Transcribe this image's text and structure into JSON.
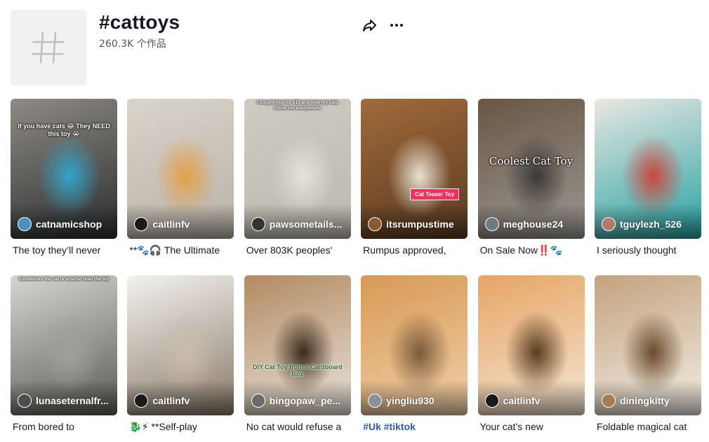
{
  "header": {
    "title": "#cattoys",
    "count": "260.3K 个作品",
    "share_icon": "share-icon",
    "more_icon": "more-icon"
  },
  "videos": [
    {
      "author": "catnamicshop",
      "caption": "The toy they’ll never",
      "overlay": "If you have cats 😂 They NEED this toy 😭",
      "colors": [
        "#8f8a82",
        "#2a2e31",
        "#2fa5c9"
      ],
      "avatar_color": "#4a90c2"
    },
    {
      "author": "caitlinfv",
      "caption": "**🐾🎧 The Ultimate",
      "overlay": "",
      "colors": [
        "#d9d4cc",
        "#b8b2a6",
        "#e2a14a"
      ],
      "avatar_color": "#1a1a1a"
    },
    {
      "author": "pawsometails...",
      "caption": "Over 803K peoples'",
      "overlay": "I bought this for $10 and now my cats follow me everywhere",
      "colors": [
        "#cfcbc3",
        "#bdb8ae",
        "#e6e2da"
      ],
      "avatar_color": "#333333"
    },
    {
      "author": "itsrumpustime",
      "caption": "Rumpus approved,",
      "overlay": "Cat Teaser Toy",
      "colors": [
        "#a06a3c",
        "#5b3a1f",
        "#e9e1d4"
      ],
      "avatar_color": "#8a5a33"
    },
    {
      "author": "meghouse24",
      "caption": "On Sale Now‼️🐾",
      "overlay": "Coolest Cat Toy",
      "colors": [
        "#6a5644",
        "#9b9893",
        "#3c3a38"
      ],
      "avatar_color": "#6f7a7f"
    },
    {
      "author": "tguylezh_526",
      "caption": "I seriously thought",
      "overlay": "",
      "colors": [
        "#e9e7e2",
        "#27a3a3",
        "#c8473d"
      ],
      "avatar_color": "#b37a6a"
    },
    {
      "author": "lunaseternalfr...",
      "caption": "From bored to",
      "overlay": "Sometimes the cat is smarter than the toy",
      "colors": [
        "#d8d6d2",
        "#5d5a55",
        "#a29f99"
      ],
      "avatar_color": "#4d4d4d"
    },
    {
      "author": "caitlinfv",
      "caption": "🐉⚡ **Self-play",
      "overlay": "",
      "colors": [
        "#f2f2f0",
        "#8a7a68",
        "#c9bca9"
      ],
      "avatar_color": "#1a1a1a"
    },
    {
      "author": "bingopaw_pe...",
      "caption": "No cat would refuse a",
      "overlay": "DIY Cat Toy from a Cardboard Box",
      "colors": [
        "#b48a62",
        "#e7e2d9",
        "#3a2a1a"
      ],
      "avatar_color": "#6b6b6b"
    },
    {
      "author": "yingliu930",
      "caption": "#Uk #tiktok",
      "overlay": "",
      "colors": [
        "#d79a55",
        "#f0cfa8",
        "#7a5a3a"
      ],
      "avatar_color": "#8a8f9a"
    },
    {
      "author": "caitlinfv",
      "caption": "Your cat’s new",
      "overlay": "",
      "colors": [
        "#e6a565",
        "#f4e5d2",
        "#5a3b1e"
      ],
      "avatar_color": "#1a1a1a"
    },
    {
      "author": "diningkitty",
      "caption": "Foldable magical cat",
      "overlay": "",
      "colors": [
        "#c4a27e",
        "#f1ede5",
        "#6a4a2e"
      ],
      "avatar_color": "#a67c52"
    }
  ]
}
